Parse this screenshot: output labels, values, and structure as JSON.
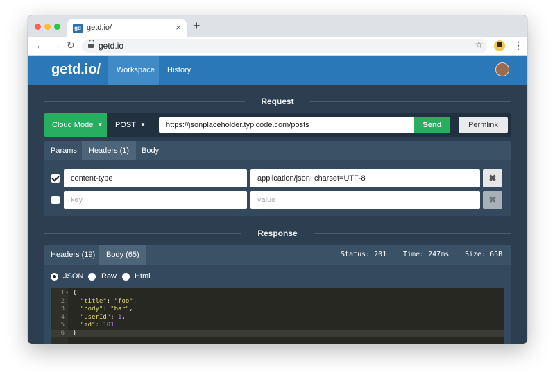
{
  "browser": {
    "tab_title": "getd.io/",
    "favicon_text": "gd",
    "close": "×",
    "new_tab": "+",
    "address": "getd.io"
  },
  "app": {
    "brand": "getd.io/",
    "nav": [
      "Workspace",
      "History"
    ],
    "active_nav": "Workspace"
  },
  "request": {
    "section_title": "Request",
    "mode": "Cloud Mode",
    "method": "POST",
    "url": "https://jsonplaceholder.typicode.com/posts",
    "send_label": "Send",
    "permlink_label": "Permlink",
    "tabs": [
      "Params",
      "Headers (1)",
      "Body"
    ],
    "active_tab": "Headers (1)",
    "headers": [
      {
        "checked": true,
        "key": "content-type",
        "value": "application/json; charset=UTF-8"
      },
      {
        "checked": false,
        "key_placeholder": "key",
        "value_placeholder": "value"
      }
    ],
    "remove_label": "✖"
  },
  "response": {
    "section_title": "Response",
    "tabs": [
      "Headers (19)",
      "Body (65)"
    ],
    "active_tab": "Body (65)",
    "status": "Status: 201",
    "time": "Time: 247ms",
    "size": "Size: 65B",
    "formats": [
      "JSON",
      "Raw",
      "Html"
    ],
    "selected_format": "JSON",
    "body_lines": [
      {
        "num": "1",
        "fold": "▾",
        "text": "{"
      },
      {
        "num": "2",
        "key": "\"title\"",
        "val": "\"foo\"",
        "kind": "str",
        "comma": ","
      },
      {
        "num": "3",
        "key": "\"body\"",
        "val": "\"bar\"",
        "kind": "str",
        "comma": ","
      },
      {
        "num": "4",
        "key": "\"userId\"",
        "val": "1",
        "kind": "num",
        "comma": ","
      },
      {
        "num": "5",
        "key": "\"id\"",
        "val": "101",
        "kind": "num",
        "comma": ""
      },
      {
        "num": "6",
        "text": "}"
      }
    ]
  }
}
